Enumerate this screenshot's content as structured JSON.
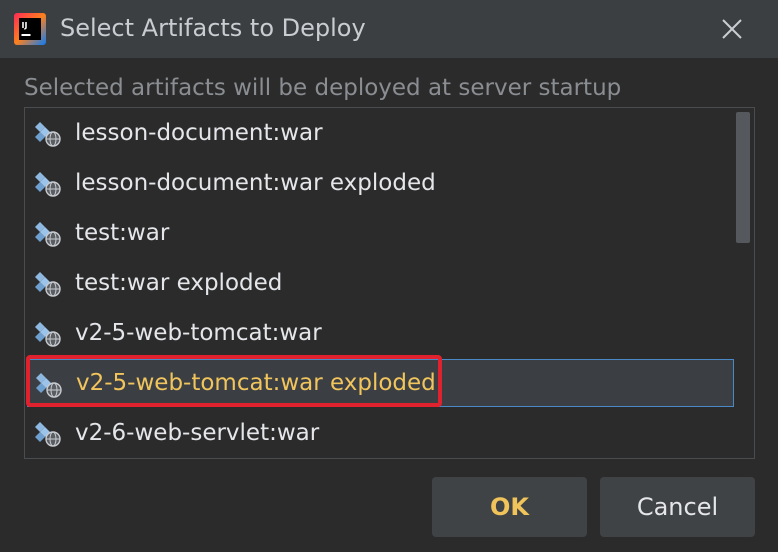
{
  "window": {
    "title": "Select Artifacts to Deploy",
    "app_icon": "intellij-idea-icon",
    "close_icon": "close-icon"
  },
  "subtitle": "Selected artifacts will be deployed at server startup",
  "artifacts": [
    {
      "label": "lesson-document:war",
      "icon": "web-artifact-icon",
      "selected": false
    },
    {
      "label": "lesson-document:war exploded",
      "icon": "web-artifact-icon",
      "selected": false
    },
    {
      "label": "test:war",
      "icon": "web-artifact-icon",
      "selected": false
    },
    {
      "label": "test:war exploded",
      "icon": "web-artifact-icon",
      "selected": false
    },
    {
      "label": "v2-5-web-tomcat:war",
      "icon": "web-artifact-icon",
      "selected": false
    },
    {
      "label": "v2-5-web-tomcat:war exploded",
      "icon": "web-artifact-icon",
      "selected": true
    },
    {
      "label": "v2-6-web-servlet:war",
      "icon": "web-artifact-icon",
      "selected": false
    }
  ],
  "buttons": {
    "ok_label": "OK",
    "cancel_label": "Cancel"
  },
  "colors": {
    "selected_text": "#f2c55c",
    "ok_text": "#f0c45a",
    "highlight": "#e0222f",
    "selection_border": "#4a88c7"
  }
}
